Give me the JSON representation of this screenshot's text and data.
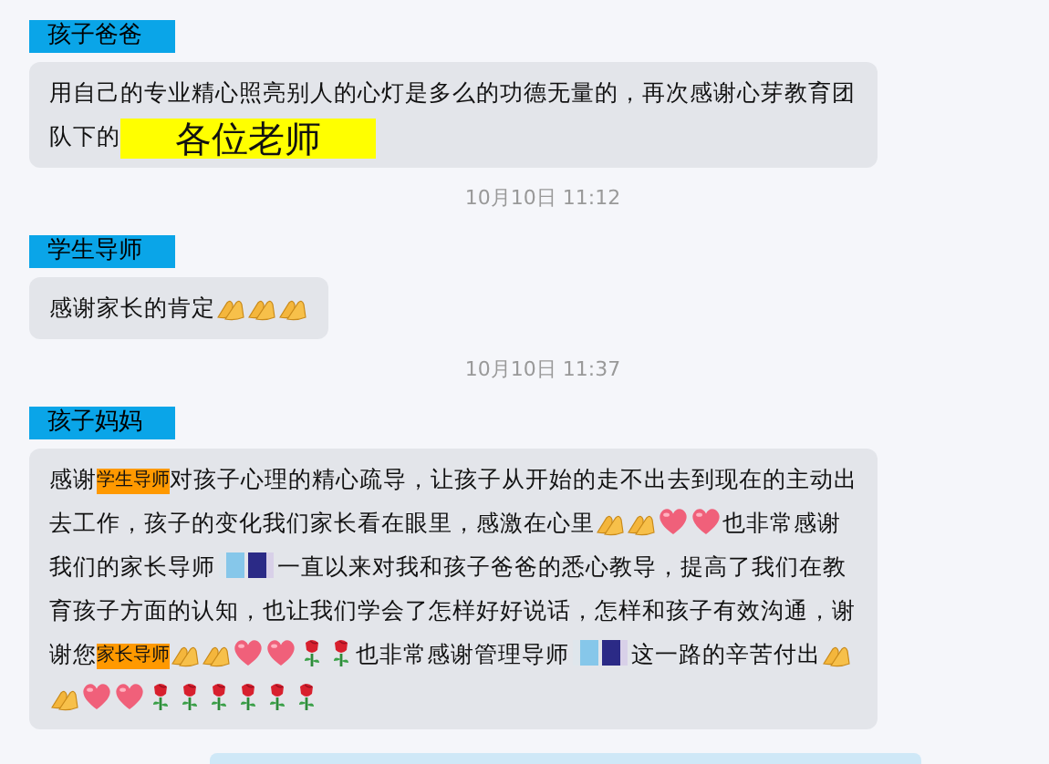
{
  "chat": [
    {
      "kind": "message",
      "sender": "孩子爸爸",
      "content": [
        {
          "kind": "text",
          "text": "用自己的专业精心照亮别人的心灯是多么的功德无量的，再次感谢心芽教育团队下的"
        },
        {
          "kind": "banner",
          "text": "各位老师",
          "color": "#ffff00"
        }
      ]
    },
    {
      "kind": "time",
      "text": "10月10日 11:12"
    },
    {
      "kind": "message",
      "sender": "学生导师",
      "content": [
        {
          "kind": "text",
          "text": "感谢家长的肯定"
        },
        {
          "kind": "palms"
        },
        {
          "kind": "palms"
        },
        {
          "kind": "palms"
        }
      ]
    },
    {
      "kind": "time",
      "text": "10月10日 11:37"
    },
    {
      "kind": "message",
      "sender": "孩子妈妈",
      "content": [
        {
          "kind": "text",
          "text": "感谢"
        },
        {
          "kind": "tag",
          "text": "学生导师",
          "color": "#ff9900"
        },
        {
          "kind": "text",
          "text": "对孩子心理的精心疏导，让孩子从开始的走不出去到现在的主动出去工作，孩子的变化我们家长看在眼里，感激在心里"
        },
        {
          "kind": "palms"
        },
        {
          "kind": "palms"
        },
        {
          "kind": "heart"
        },
        {
          "kind": "heart"
        },
        {
          "kind": "text",
          "text": "也非常感谢我们的家长导师"
        },
        {
          "kind": "mosaic"
        },
        {
          "kind": "text",
          "text": "一直以来对我和孩子爸爸的悉心教导，提高了我们在教育孩子方面的认知，也让我们学会了怎样好好说话，怎样和孩子有效沟通，谢谢您"
        },
        {
          "kind": "tag",
          "text": "家长导师",
          "color": "#ff9900"
        },
        {
          "kind": "palms"
        },
        {
          "kind": "palms"
        },
        {
          "kind": "heart"
        },
        {
          "kind": "heart"
        },
        {
          "kind": "rose"
        },
        {
          "kind": "rose"
        },
        {
          "kind": "text",
          "text": "也非常感谢管理导师"
        },
        {
          "kind": "mosaic"
        },
        {
          "kind": "text",
          "text": "这一路的辛苦付出"
        },
        {
          "kind": "palms"
        },
        {
          "kind": "palms"
        },
        {
          "kind": "heart"
        },
        {
          "kind": "heart"
        },
        {
          "kind": "rose"
        },
        {
          "kind": "rose"
        },
        {
          "kind": "rose"
        },
        {
          "kind": "rose"
        },
        {
          "kind": "rose"
        },
        {
          "kind": "rose"
        }
      ]
    },
    {
      "kind": "partial"
    }
  ]
}
